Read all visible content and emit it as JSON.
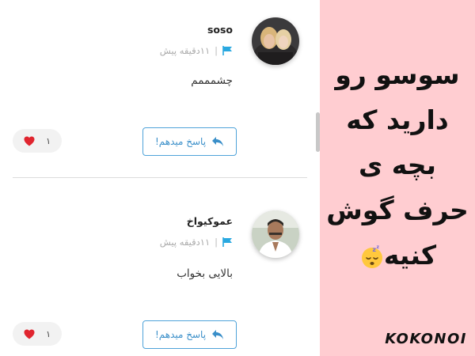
{
  "comments": [
    {
      "username": "soso",
      "time": "۱۱دقیقه پیش",
      "separator": "|",
      "text": "چشمممم",
      "reply_label": "پاسخ میدهم!",
      "likes": "۱"
    },
    {
      "username": "عموکیواخ",
      "time": "۱۱دقیقه پیش",
      "separator": "|",
      "text": "بالایی بخواب",
      "reply_label": "پاسخ میدهم!",
      "likes": "۱"
    }
  ],
  "caption": {
    "lines": [
      "سوسو رو",
      "دارید که",
      "بچه ی",
      "حرف گوش",
      "کنیه"
    ],
    "emoji": "sleeping-face-icon"
  },
  "brand": "KOKONOI",
  "colors": {
    "accent_blue": "#4fa3d9",
    "flag_blue": "#29a8e0",
    "heart_red": "#e0252f",
    "caption_bg": "#ffcdd1",
    "like_pill_bg": "#f2f2f2"
  },
  "icons": {
    "flag": "flag-icon",
    "reply": "reply-arrow-icon",
    "heart": "heart-icon"
  }
}
